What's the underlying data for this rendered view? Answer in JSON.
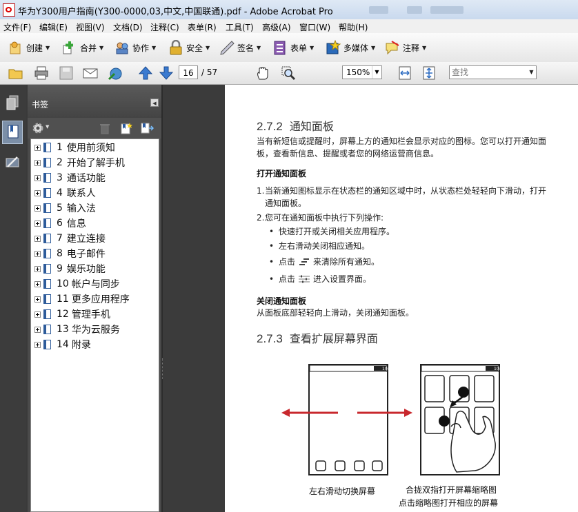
{
  "window": {
    "title": "华为Y300用户指南(Y300-0000,03,中文,中国联通).pdf - Adobe Acrobat Pro"
  },
  "menu": [
    "文件(F)",
    "编辑(E)",
    "视图(V)",
    "文档(D)",
    "注释(C)",
    "表单(R)",
    "工具(T)",
    "高级(A)",
    "窗口(W)",
    "帮助(H)"
  ],
  "toolbar": {
    "create": "创建",
    "combine": "合并",
    "collaborate": "协作",
    "secure": "安全",
    "sign": "签名",
    "forms": "表单",
    "multimedia": "多媒体",
    "comment": "注释"
  },
  "nav": {
    "current_page": "16",
    "total_pages": "/ 57",
    "zoom": "150%",
    "search_placeholder": "查找"
  },
  "bookmarks": {
    "title": "书签",
    "items": [
      {
        "num": "1",
        "label": "使用前须知"
      },
      {
        "num": "2",
        "label": "开始了解手机"
      },
      {
        "num": "3",
        "label": "通话功能"
      },
      {
        "num": "4",
        "label": "联系人"
      },
      {
        "num": "5",
        "label": "输入法"
      },
      {
        "num": "6",
        "label": "信息"
      },
      {
        "num": "7",
        "label": "建立连接"
      },
      {
        "num": "8",
        "label": "电子邮件"
      },
      {
        "num": "9",
        "label": "娱乐功能"
      },
      {
        "num": "10",
        "label": "帐户与同步"
      },
      {
        "num": "11",
        "label": "更多应用程序"
      },
      {
        "num": "12",
        "label": "管理手机"
      },
      {
        "num": "13",
        "label": "华为云服务"
      },
      {
        "num": "14",
        "label": "附录"
      }
    ]
  },
  "doc": {
    "s1_num": "2.7.2",
    "s1_title": "通知面板",
    "s1_p1": "当有新短信或提醒时，屏幕上方的通知栏会显示对应的图标。您可以打开通知面板，查看新信息、提醒或者您的网络运营商信息。",
    "open_title": "打开通知面板",
    "step1_num": "1.",
    "step1": "当新通知图标显示在状态栏的通知区域中时，从状态栏处轻轻向下滑动，打开通知面板。",
    "step2_num": "2.",
    "step2": "您可在通知面板中执行下列操作:",
    "b1": "快速打开或关闭相关应用程序。",
    "b2": "左右滑动关闭相应通知。",
    "b3_pre": "点击",
    "b3_post": "来清除所有通知。",
    "b4_pre": "点击",
    "b4_post": "进入设置界面。",
    "close_title": "关闭通知面板",
    "close_p": "从面板底部轻轻向上滑动，关闭通知面板。",
    "s2_num": "2.7.3",
    "s2_title": "查看扩展屏幕界面",
    "clock": "10:23",
    "cap_left": "左右滑动切换屏幕",
    "cap_right1": "合拢双指打开屏幕缩略图",
    "cap_right2": "点击缩略图打开相应的屏幕"
  },
  "colors": {
    "arrow_red": "#c8282d",
    "nav_active": "#7c8fa7",
    "titlebar": "#dfe9f5"
  }
}
